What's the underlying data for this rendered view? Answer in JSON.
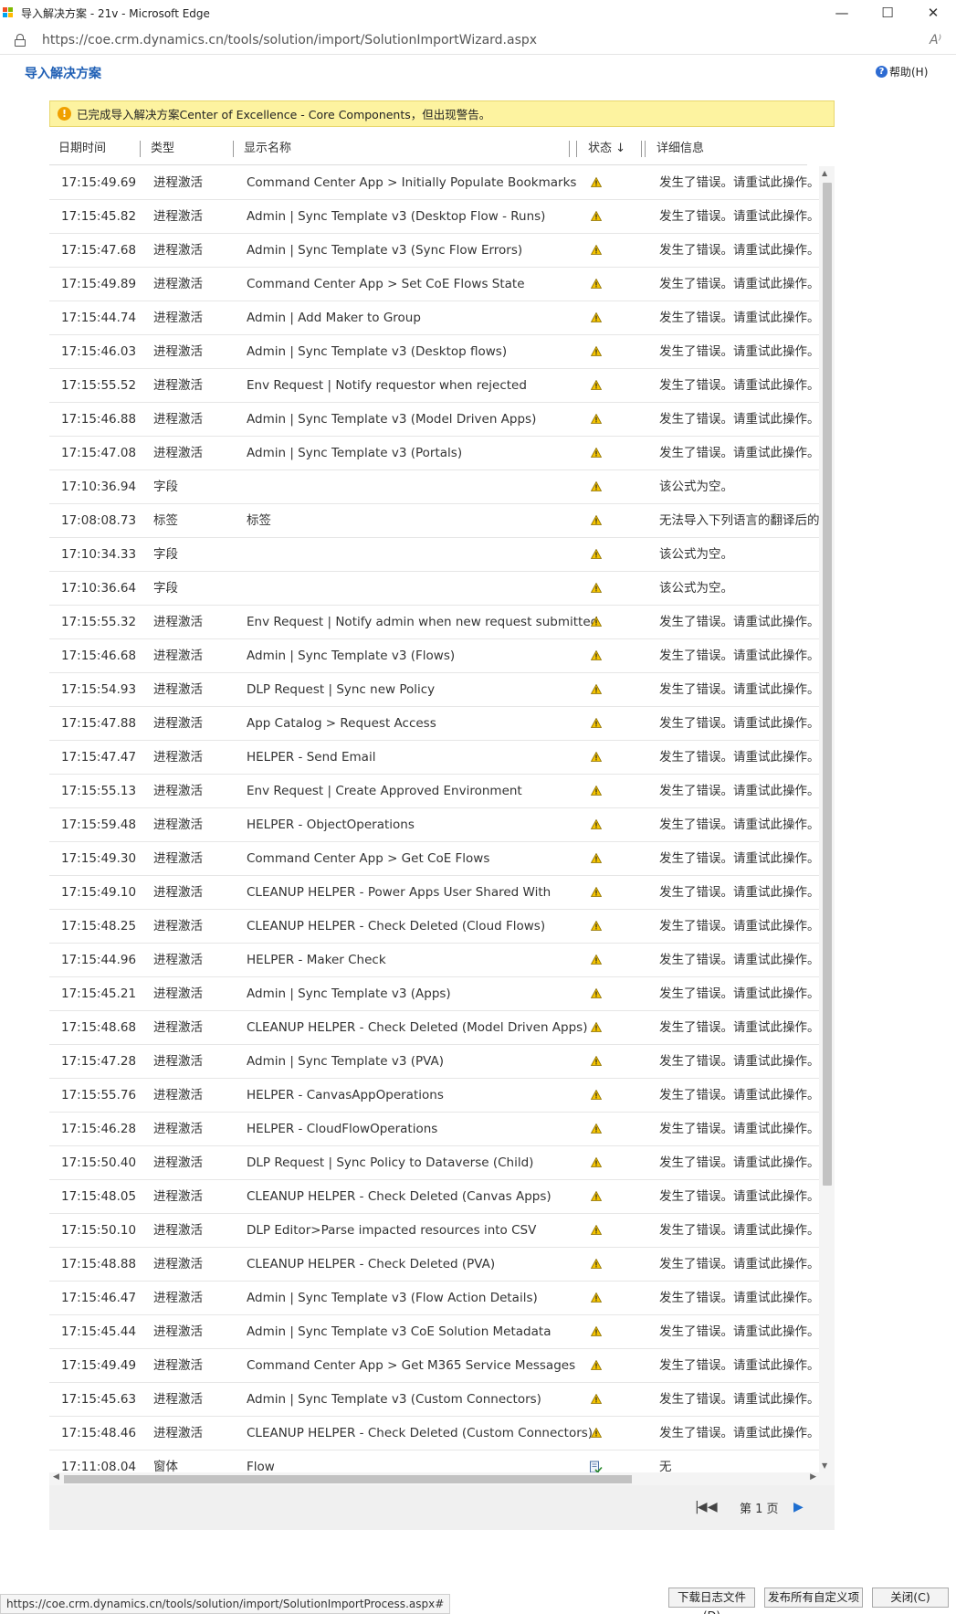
{
  "window": {
    "title": "导入解决方案 - 21v - Microsoft Edge",
    "minimize_glyph": "—",
    "maximize_glyph": "☐",
    "close_glyph": "✕"
  },
  "addressbar": {
    "url": "https://coe.crm.dynamics.cn/tools/solution/import/SolutionImportWizard.aspx",
    "read_aloud_glyph": "A⁾"
  },
  "header": {
    "title": "导入解决方案",
    "help_label": "帮助(H)",
    "help_glyph": "?"
  },
  "banner": {
    "icon_glyph": "!",
    "text": "已完成导入解决方案Center of Excellence - Core Components，但出现警告。"
  },
  "grid": {
    "columns": {
      "datetime": "日期时间",
      "type": "类型",
      "display_name": "显示名称",
      "status": "状态 ↓",
      "details": "详细信息"
    },
    "rows": [
      {
        "time": "17:15:49.69",
        "type": "进程激活",
        "name": "Command Center App > Initially Populate Bookmarks",
        "status": "warning",
        "detail": "发生了错误。请重试此操作。如"
      },
      {
        "time": "17:15:45.82",
        "type": "进程激活",
        "name": "Admin | Sync Template v3 (Desktop Flow - Runs)",
        "status": "warning",
        "detail": "发生了错误。请重试此操作。如"
      },
      {
        "time": "17:15:47.68",
        "type": "进程激活",
        "name": "Admin | Sync Template v3 (Sync Flow Errors)",
        "status": "warning",
        "detail": "发生了错误。请重试此操作。如"
      },
      {
        "time": "17:15:49.89",
        "type": "进程激活",
        "name": "Command Center App > Set CoE Flows State",
        "status": "warning",
        "detail": "发生了错误。请重试此操作。如"
      },
      {
        "time": "17:15:44.74",
        "type": "进程激活",
        "name": "Admin | Add Maker to Group",
        "status": "warning",
        "detail": "发生了错误。请重试此操作。如"
      },
      {
        "time": "17:15:46.03",
        "type": "进程激活",
        "name": "Admin | Sync Template v3 (Desktop flows)",
        "status": "warning",
        "detail": "发生了错误。请重试此操作。如"
      },
      {
        "time": "17:15:55.52",
        "type": "进程激活",
        "name": "Env Request | Notify requestor when rejected",
        "status": "warning",
        "detail": "发生了错误。请重试此操作。如"
      },
      {
        "time": "17:15:46.88",
        "type": "进程激活",
        "name": "Admin | Sync Template v3 (Model Driven Apps)",
        "status": "warning",
        "detail": "发生了错误。请重试此操作。如"
      },
      {
        "time": "17:15:47.08",
        "type": "进程激活",
        "name": "Admin | Sync Template v3 (Portals)",
        "status": "warning",
        "detail": "发生了错误。请重试此操作。如"
      },
      {
        "time": "17:10:36.94",
        "type": "字段",
        "name": "",
        "status": "warning",
        "detail": "该公式为空。"
      },
      {
        "time": "17:08:08.73",
        "type": "标签",
        "name": "标签",
        "status": "warning",
        "detail": "无法导入下列语言的翻译后的标"
      },
      {
        "time": "17:10:34.33",
        "type": "字段",
        "name": "",
        "status": "warning",
        "detail": "该公式为空。"
      },
      {
        "time": "17:10:36.64",
        "type": "字段",
        "name": "",
        "status": "warning",
        "detail": "该公式为空。"
      },
      {
        "time": "17:15:55.32",
        "type": "进程激活",
        "name": "Env Request | Notify admin when new request submitted",
        "status": "warning",
        "detail": "发生了错误。请重试此操作。如"
      },
      {
        "time": "17:15:46.68",
        "type": "进程激活",
        "name": "Admin | Sync Template v3 (Flows)",
        "status": "warning",
        "detail": "发生了错误。请重试此操作。如"
      },
      {
        "time": "17:15:54.93",
        "type": "进程激活",
        "name": "DLP Request | Sync new Policy",
        "status": "warning",
        "detail": "发生了错误。请重试此操作。如"
      },
      {
        "time": "17:15:47.88",
        "type": "进程激活",
        "name": "App Catalog > Request Access",
        "status": "warning",
        "detail": "发生了错误。请重试此操作。如"
      },
      {
        "time": "17:15:47.47",
        "type": "进程激活",
        "name": "HELPER - Send Email",
        "status": "warning",
        "detail": "发生了错误。请重试此操作。如"
      },
      {
        "time": "17:15:55.13",
        "type": "进程激活",
        "name": "Env Request | Create Approved Environment",
        "status": "warning",
        "detail": "发生了错误。请重试此操作。如"
      },
      {
        "time": "17:15:59.48",
        "type": "进程激活",
        "name": "HELPER - ObjectOperations",
        "status": "warning",
        "detail": "发生了错误。请重试此操作。如"
      },
      {
        "time": "17:15:49.30",
        "type": "进程激活",
        "name": "Command Center App > Get CoE Flows",
        "status": "warning",
        "detail": "发生了错误。请重试此操作。如"
      },
      {
        "time": "17:15:49.10",
        "type": "进程激活",
        "name": "CLEANUP HELPER - Power Apps User Shared With",
        "status": "warning",
        "detail": "发生了错误。请重试此操作。如"
      },
      {
        "time": "17:15:48.25",
        "type": "进程激活",
        "name": "CLEANUP HELPER - Check Deleted (Cloud Flows)",
        "status": "warning",
        "detail": "发生了错误。请重试此操作。如"
      },
      {
        "time": "17:15:44.96",
        "type": "进程激活",
        "name": "HELPER - Maker Check",
        "status": "warning",
        "detail": "发生了错误。请重试此操作。如"
      },
      {
        "time": "17:15:45.21",
        "type": "进程激活",
        "name": "Admin | Sync Template v3 (Apps)",
        "status": "warning",
        "detail": "发生了错误。请重试此操作。如"
      },
      {
        "time": "17:15:48.68",
        "type": "进程激活",
        "name": "CLEANUP HELPER - Check Deleted (Model Driven Apps)",
        "status": "warning",
        "detail": "发生了错误。请重试此操作。如"
      },
      {
        "time": "17:15:47.28",
        "type": "进程激活",
        "name": "Admin | Sync Template v3 (PVA)",
        "status": "warning",
        "detail": "发生了错误。请重试此操作。如"
      },
      {
        "time": "17:15:55.76",
        "type": "进程激活",
        "name": "HELPER - CanvasAppOperations",
        "status": "warning",
        "detail": "发生了错误。请重试此操作。如"
      },
      {
        "time": "17:15:46.28",
        "type": "进程激活",
        "name": "HELPER - CloudFlowOperations",
        "status": "warning",
        "detail": "发生了错误。请重试此操作。如"
      },
      {
        "time": "17:15:50.40",
        "type": "进程激活",
        "name": "DLP Request | Sync Policy to Dataverse (Child)",
        "status": "warning",
        "detail": "发生了错误。请重试此操作。如"
      },
      {
        "time": "17:15:48.05",
        "type": "进程激活",
        "name": "CLEANUP HELPER - Check Deleted (Canvas Apps)",
        "status": "warning",
        "detail": "发生了错误。请重试此操作。如"
      },
      {
        "time": "17:15:50.10",
        "type": "进程激活",
        "name": "DLP Editor>Parse impacted resources into CSV",
        "status": "warning",
        "detail": "发生了错误。请重试此操作。如"
      },
      {
        "time": "17:15:48.88",
        "type": "进程激活",
        "name": "CLEANUP HELPER - Check Deleted (PVA)",
        "status": "warning",
        "detail": "发生了错误。请重试此操作。如"
      },
      {
        "time": "17:15:46.47",
        "type": "进程激活",
        "name": "Admin | Sync Template v3 (Flow Action Details)",
        "status": "warning",
        "detail": "发生了错误。请重试此操作。如"
      },
      {
        "time": "17:15:45.44",
        "type": "进程激活",
        "name": "Admin | Sync Template v3 CoE Solution Metadata",
        "status": "warning",
        "detail": "发生了错误。请重试此操作。如"
      },
      {
        "time": "17:15:49.49",
        "type": "进程激活",
        "name": "Command Center App > Get M365 Service Messages",
        "status": "warning",
        "detail": "发生了错误。请重试此操作。如"
      },
      {
        "time": "17:15:45.63",
        "type": "进程激活",
        "name": "Admin | Sync Template v3 (Custom Connectors)",
        "status": "warning",
        "detail": "发生了错误。请重试此操作。如"
      },
      {
        "time": "17:15:48.46",
        "type": "进程激活",
        "name": "CLEANUP HELPER - Check Deleted (Custom Connectors)",
        "status": "warning",
        "detail": "发生了错误。请重试此操作。如"
      },
      {
        "time": "17:11:08.04",
        "type": "窗体",
        "name": "Flow",
        "status": "success",
        "detail": "无"
      }
    ]
  },
  "pager": {
    "first_glyph": "|◀ ◀",
    "page_label": "第 1 页",
    "next_glyph": "▶"
  },
  "statusbar": {
    "link_url": "https://coe.crm.dynamics.cn/tools/solution/import/SolutionImportProcess.aspx#"
  },
  "footer": {
    "download_log_label": "下载日志文件(D)",
    "publish_all_label": "发布所有自定义项",
    "close_label": "关闭(C)"
  },
  "colors": {
    "accent": "#1f5fb5",
    "banner_bg": "#fdf3a0",
    "warning_icon": "#f5c400",
    "logo": [
      "#f25022",
      "#7fba00",
      "#00a4ef",
      "#ffb900"
    ]
  }
}
